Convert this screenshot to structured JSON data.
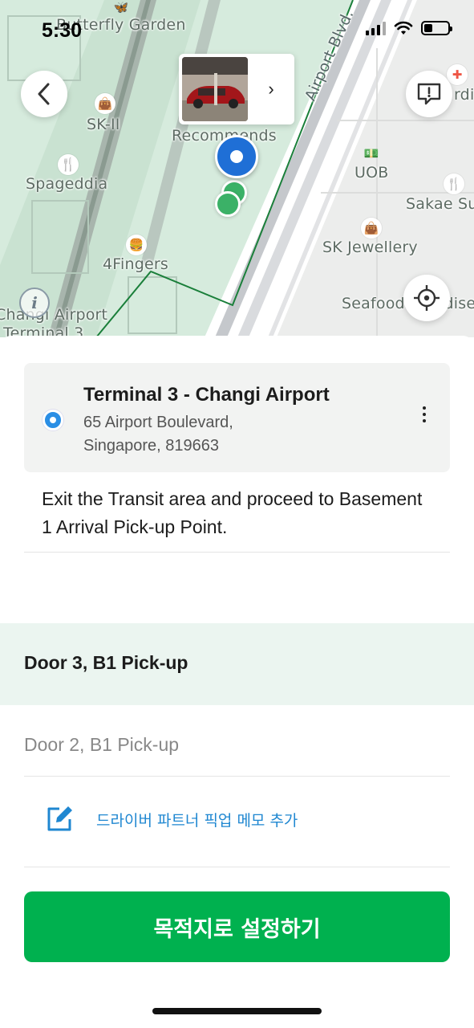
{
  "status_bar": {
    "time": "5:30"
  },
  "map": {
    "labels": {
      "butterfly_garden": "Butterfly Garden",
      "sk_ii": "SK-II",
      "spageddia": "Spageddia",
      "four_fingers": "4Fingers",
      "changi_airport": "Changi Airport",
      "terminal3": "Terminal 3",
      "recommends": "Recommends",
      "airport_blvd": "Airport Blvd.",
      "uob": "UOB",
      "sakae": "Sakae Su",
      "sk_jewellery": "SK Jewellery",
      "seafood": "Seafood Paradise",
      "cardi": "rdi"
    },
    "pin_colors": {
      "selected": "#1f6fd6",
      "nearby": "#3bb167"
    }
  },
  "place": {
    "name": "Terminal 3 - Changi Airport",
    "address_line1": "65 Airport Boulevard,",
    "address_line2": "Singapore, 819663"
  },
  "instruction": "Exit the Transit area and proceed to Basement 1 Arrival Pick-up Point.",
  "pickup_options": {
    "selected": "Door 3, B1 Pick-up",
    "other": "Door 2, B1 Pick-up"
  },
  "memo_label": "드라이버 파트너 픽업 메모 추가",
  "cta_label": "목적지로 설정하기",
  "colors": {
    "brand_green": "#00b14f",
    "accent_blue": "#1f87d1",
    "selected_bg": "#ebf5f0"
  }
}
